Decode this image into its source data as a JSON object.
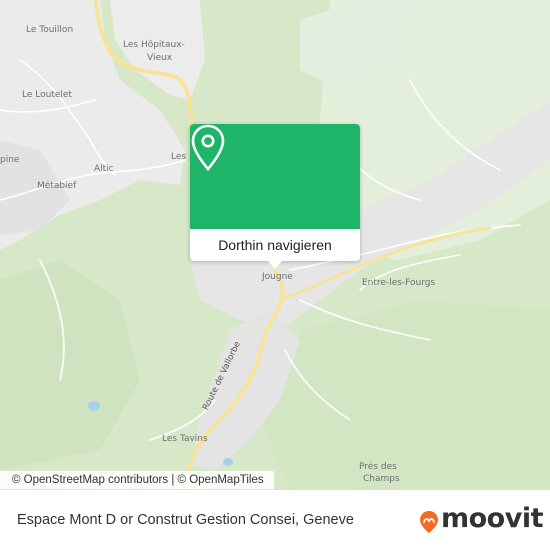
{
  "map": {
    "places": [
      {
        "id": "le-touillon",
        "label": "Le Touillon"
      },
      {
        "id": "les-hopitaux-vieux-1",
        "label": "Les Hôpitaux-"
      },
      {
        "id": "les-hopitaux-vieux-2",
        "label": "Vieux"
      },
      {
        "id": "le-loutelet",
        "label": "Le Loutelet"
      },
      {
        "id": "les-partial",
        "label": "Les"
      },
      {
        "id": "altic",
        "label": "Altic"
      },
      {
        "id": "pine-partial",
        "label": "pine"
      },
      {
        "id": "metabief",
        "label": "Métabief"
      },
      {
        "id": "jougne",
        "label": "Jougne"
      },
      {
        "id": "entre-les-fourgs",
        "label": "Entre-les-Fourgs"
      },
      {
        "id": "les-tavins",
        "label": "Les Tavins"
      },
      {
        "id": "pres-des-champs-1",
        "label": "Prés des"
      },
      {
        "id": "pres-des-champs-2",
        "label": "Champs"
      }
    ],
    "road_label": "Route de Vallorbe",
    "colors": {
      "forest": "#d6e8c8",
      "urban": "#e8e8e8",
      "road_main": "#f7e39a",
      "road_minor": "#ffffff",
      "popup_green": "#1fb568"
    }
  },
  "popup": {
    "pin_icon": "location-pin-icon",
    "button_label": "Dorthin navigieren"
  },
  "attribution": {
    "osm": "© OpenStreetMap contributors",
    "separator": "|",
    "omt": "© OpenMapTiles"
  },
  "footer": {
    "title": "Espace Mont D or Construt Gestion Consei, Geneve",
    "logo_text": "moovit",
    "logo_icon": "moovit-logo-icon",
    "logo_color": "#f26b21"
  }
}
